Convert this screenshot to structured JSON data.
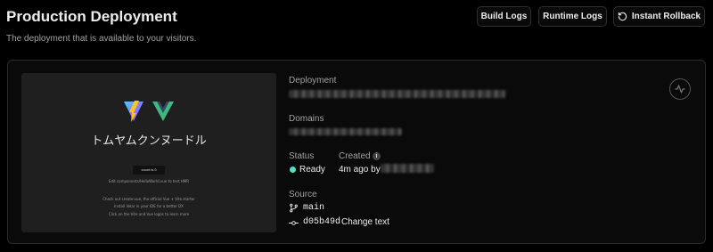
{
  "header": {
    "title": "Production Deployment",
    "subtitle": "The deployment that is available to your visitors.",
    "buttons": {
      "build_logs": "Build Logs",
      "runtime_logs": "Runtime Logs",
      "instant_rollback": "Instant Rollback"
    }
  },
  "preview": {
    "heading": "トムヤムクンヌードル",
    "count_button": "count is 0",
    "edit_line": "Edit components/HelloWorld.vue to test HMR",
    "check_line": "Check out create-vue, the official Vue + Vite starter",
    "install_line": "Install Volar in your IDE for a better DX",
    "click_line": "Click on the Vite and Vue logos to learn more"
  },
  "details": {
    "deployment_label": "Deployment",
    "domains_label": "Domains",
    "status_label": "Status",
    "status_value": "Ready",
    "status_color": "#50e3c2",
    "created_label": "Created",
    "created_value": "4m ago by",
    "source_label": "Source",
    "branch": "main",
    "commit_hash": "d05b49d",
    "commit_message": "Change text"
  },
  "icons": {
    "rollback": "rotate-ccw-icon",
    "info": "info-icon",
    "branch": "git-branch-icon",
    "commit": "git-commit-icon",
    "activity": "activity-icon"
  }
}
